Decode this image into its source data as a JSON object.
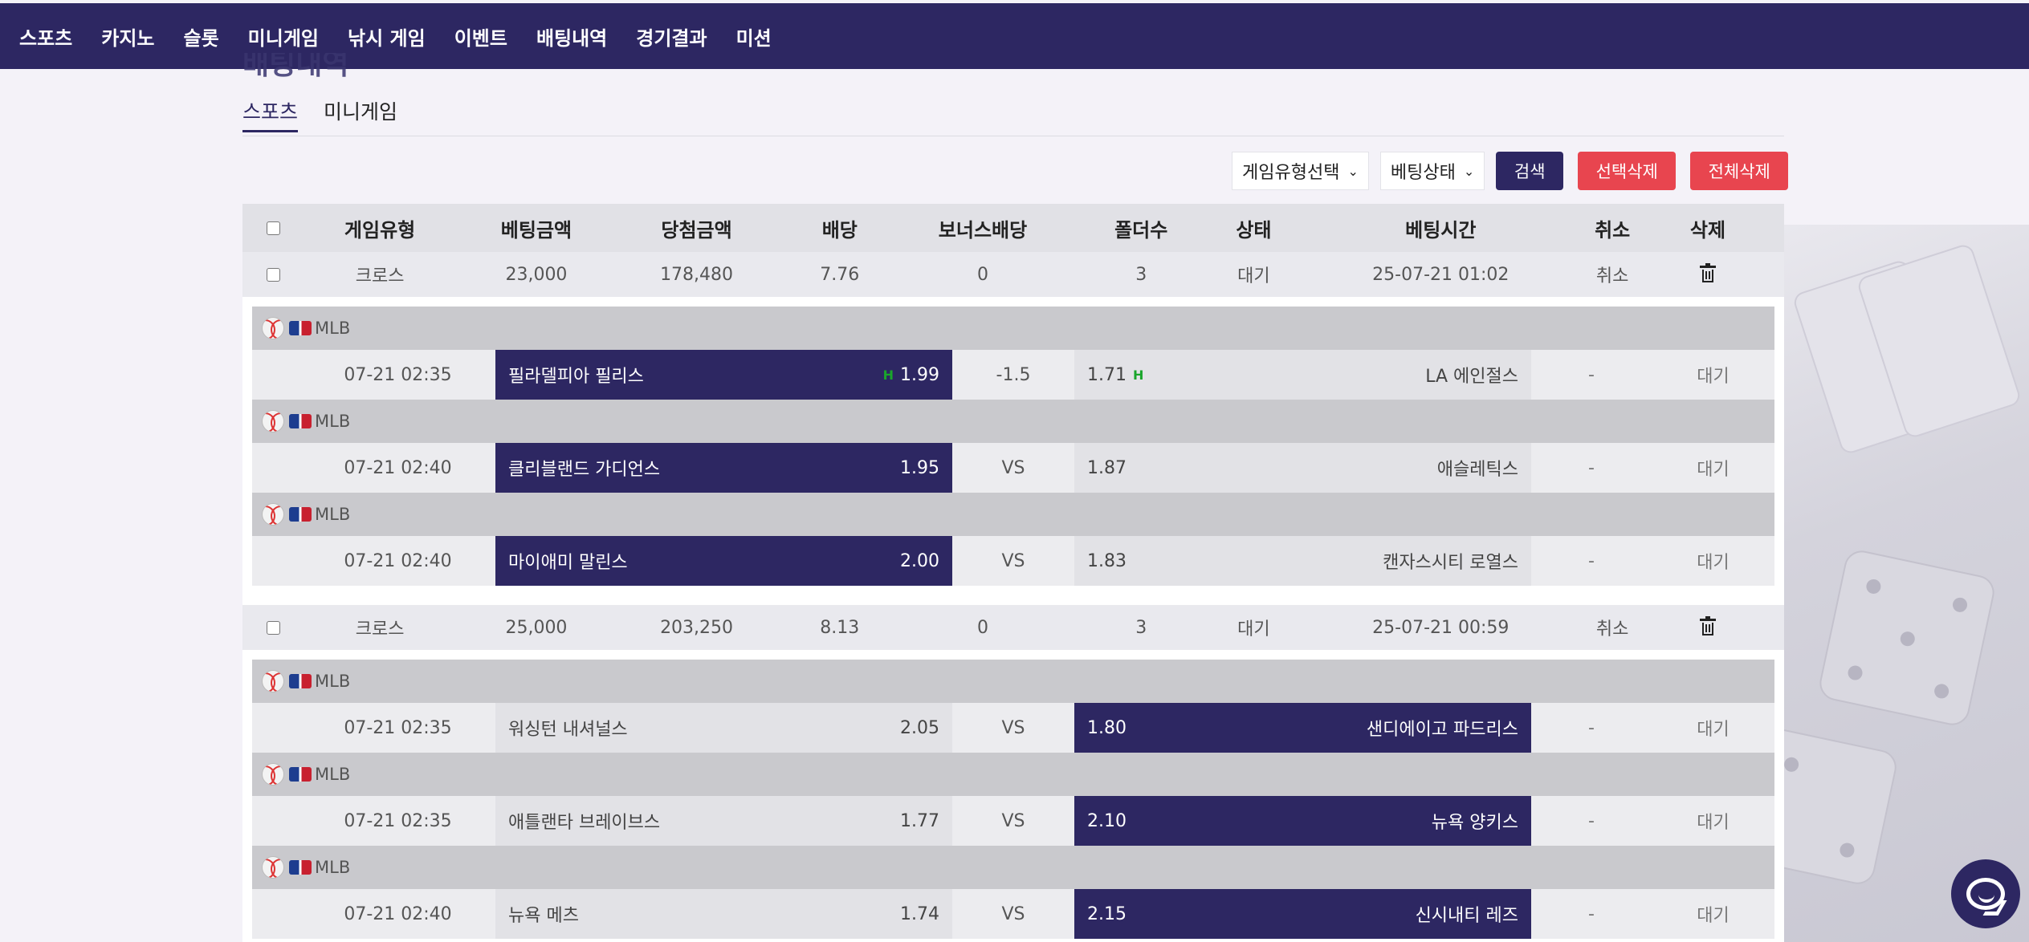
{
  "nav": [
    "스포츠",
    "카지노",
    "슬롯",
    "미니게임",
    "낚시 게임",
    "이벤트",
    "배팅내역",
    "경기결과",
    "미션"
  ],
  "page_title": "배팅내역",
  "subtabs": [
    "스포츠",
    "미니게임"
  ],
  "filters": {
    "game_type": "게임유형선택",
    "bet_status": "베팅상태",
    "search": "검색",
    "delete_selected": "선택삭제",
    "delete_all": "전체삭제"
  },
  "columns": [
    "게임유형",
    "베팅금액",
    "당첨금액",
    "배당",
    "보너스배당",
    "폴더수",
    "상태",
    "베팅시간",
    "취소",
    "삭제"
  ],
  "bets": [
    {
      "type": "크로스",
      "amount": "23,000",
      "win": "178,480",
      "odds": "7.76",
      "bonus": "0",
      "folders": "3",
      "status": "대기",
      "time": "25-07-21 01:02",
      "cancel": "취소",
      "matches": [
        {
          "league": "MLB",
          "time": "07-21 02:35",
          "home": "필라델피아 필리스",
          "home_odds": "1.99",
          "home_mark": "H",
          "mid": "-1.5",
          "away_odds": "1.71",
          "away_mark": "H",
          "away": "LA 에인절스",
          "dash": "-",
          "status": "대기",
          "pick": "home"
        },
        {
          "league": "MLB",
          "time": "07-21 02:40",
          "home": "클리블랜드 가디언스",
          "home_odds": "1.95",
          "mid": "VS",
          "away_odds": "1.87",
          "away": "애슬레틱스",
          "dash": "-",
          "status": "대기",
          "pick": "home"
        },
        {
          "league": "MLB",
          "time": "07-21 02:40",
          "home": "마이애미 말린스",
          "home_odds": "2.00",
          "mid": "VS",
          "away_odds": "1.83",
          "away": "캔자스시티 로열스",
          "dash": "-",
          "status": "대기",
          "pick": "home"
        }
      ]
    },
    {
      "type": "크로스",
      "amount": "25,000",
      "win": "203,250",
      "odds": "8.13",
      "bonus": "0",
      "folders": "3",
      "status": "대기",
      "time": "25-07-21 00:59",
      "cancel": "취소",
      "matches": [
        {
          "league": "MLB",
          "time": "07-21 02:35",
          "home": "워싱턴 내셔널스",
          "home_odds": "2.05",
          "mid": "VS",
          "away_odds": "1.80",
          "away": "샌디에이고 파드리스",
          "dash": "-",
          "status": "대기",
          "pick": "away"
        },
        {
          "league": "MLB",
          "time": "07-21 02:35",
          "home": "애틀랜타 브레이브스",
          "home_odds": "1.77",
          "mid": "VS",
          "away_odds": "2.10",
          "away": "뉴욕 양키스",
          "dash": "-",
          "status": "대기",
          "pick": "away"
        },
        {
          "league": "MLB",
          "time": "07-21 02:40",
          "home": "뉴욕 메츠",
          "home_odds": "1.74",
          "mid": "VS",
          "away_odds": "2.15",
          "away": "신시내티 레즈",
          "dash": "-",
          "status": "대기",
          "pick": "away"
        }
      ]
    }
  ]
}
